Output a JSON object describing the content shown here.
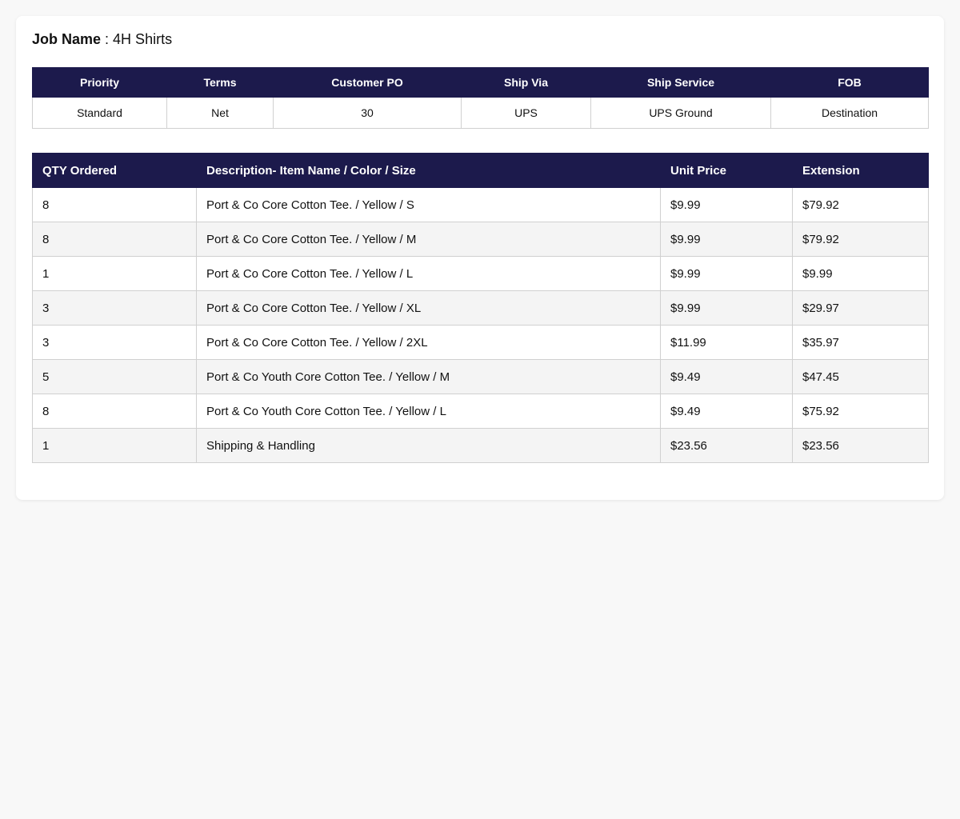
{
  "job": {
    "label": "Job Name",
    "separator": " : ",
    "value": "4H Shirts"
  },
  "meta": {
    "headers": [
      "Priority",
      "Terms",
      "Customer PO",
      "Ship Via",
      "Ship Service",
      "FOB"
    ],
    "values": [
      "Standard",
      "Net",
      "30",
      "UPS",
      "UPS Ground",
      "Destination"
    ]
  },
  "items": {
    "headers": [
      "QTY Ordered",
      "Description- Item Name / Color / Size",
      "Unit Price",
      "Extension"
    ],
    "rows": [
      {
        "qty": "8",
        "desc": "Port & Co Core Cotton Tee. / Yellow / S",
        "price": "$9.99",
        "ext": "$79.92"
      },
      {
        "qty": "8",
        "desc": "Port & Co Core Cotton Tee. / Yellow / M",
        "price": "$9.99",
        "ext": "$79.92"
      },
      {
        "qty": "1",
        "desc": "Port & Co Core Cotton Tee. / Yellow / L",
        "price": "$9.99",
        "ext": "$9.99"
      },
      {
        "qty": "3",
        "desc": "Port & Co Core Cotton Tee. / Yellow / XL",
        "price": "$9.99",
        "ext": "$29.97"
      },
      {
        "qty": "3",
        "desc": "Port & Co Core Cotton Tee. / Yellow / 2XL",
        "price": "$11.99",
        "ext": "$35.97"
      },
      {
        "qty": "5",
        "desc": "Port & Co Youth Core Cotton Tee. / Yellow / M",
        "price": "$9.49",
        "ext": "$47.45"
      },
      {
        "qty": "8",
        "desc": "Port & Co Youth Core Cotton Tee. / Yellow / L",
        "price": "$9.49",
        "ext": "$75.92"
      },
      {
        "qty": "1",
        "desc": "Shipping & Handling",
        "price": "$23.56",
        "ext": "$23.56"
      }
    ]
  },
  "colors": {
    "header_bg": "#1c1a4c",
    "page_bg": "#f8f8f8",
    "row_alt_bg": "#f4f4f4"
  }
}
